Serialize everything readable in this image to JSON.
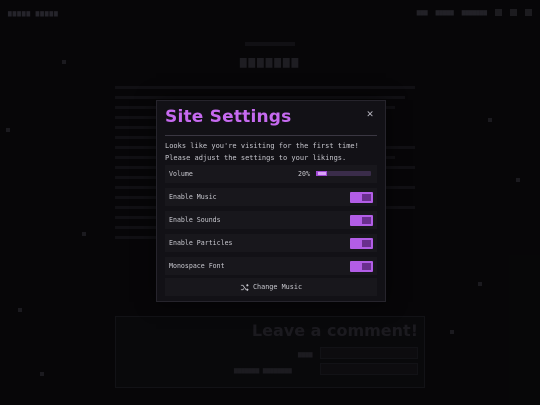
{
  "modal": {
    "title": "Site Settings",
    "close_glyph": "✕",
    "intro_line1": "Looks like you're visiting for the first time!",
    "intro_line2": "Please adjust the settings to your likings.",
    "volume": {
      "label": "Volume",
      "value_text": "20%",
      "value": 0.2
    },
    "toggles": [
      {
        "label": "Enable Music",
        "on": true
      },
      {
        "label": "Enable Sounds",
        "on": true
      },
      {
        "label": "Enable Particles",
        "on": true
      },
      {
        "label": "Monospace Font",
        "on": true
      }
    ],
    "change_music_label": "Change Music"
  },
  "background": {
    "comment_title": "Leave a comment!"
  },
  "colors": {
    "accent": "#c66af0",
    "toggle_on": "#b25de6",
    "panel": "#121116"
  },
  "icons": {
    "close": "close-icon",
    "shuffle": "shuffle-icon"
  }
}
